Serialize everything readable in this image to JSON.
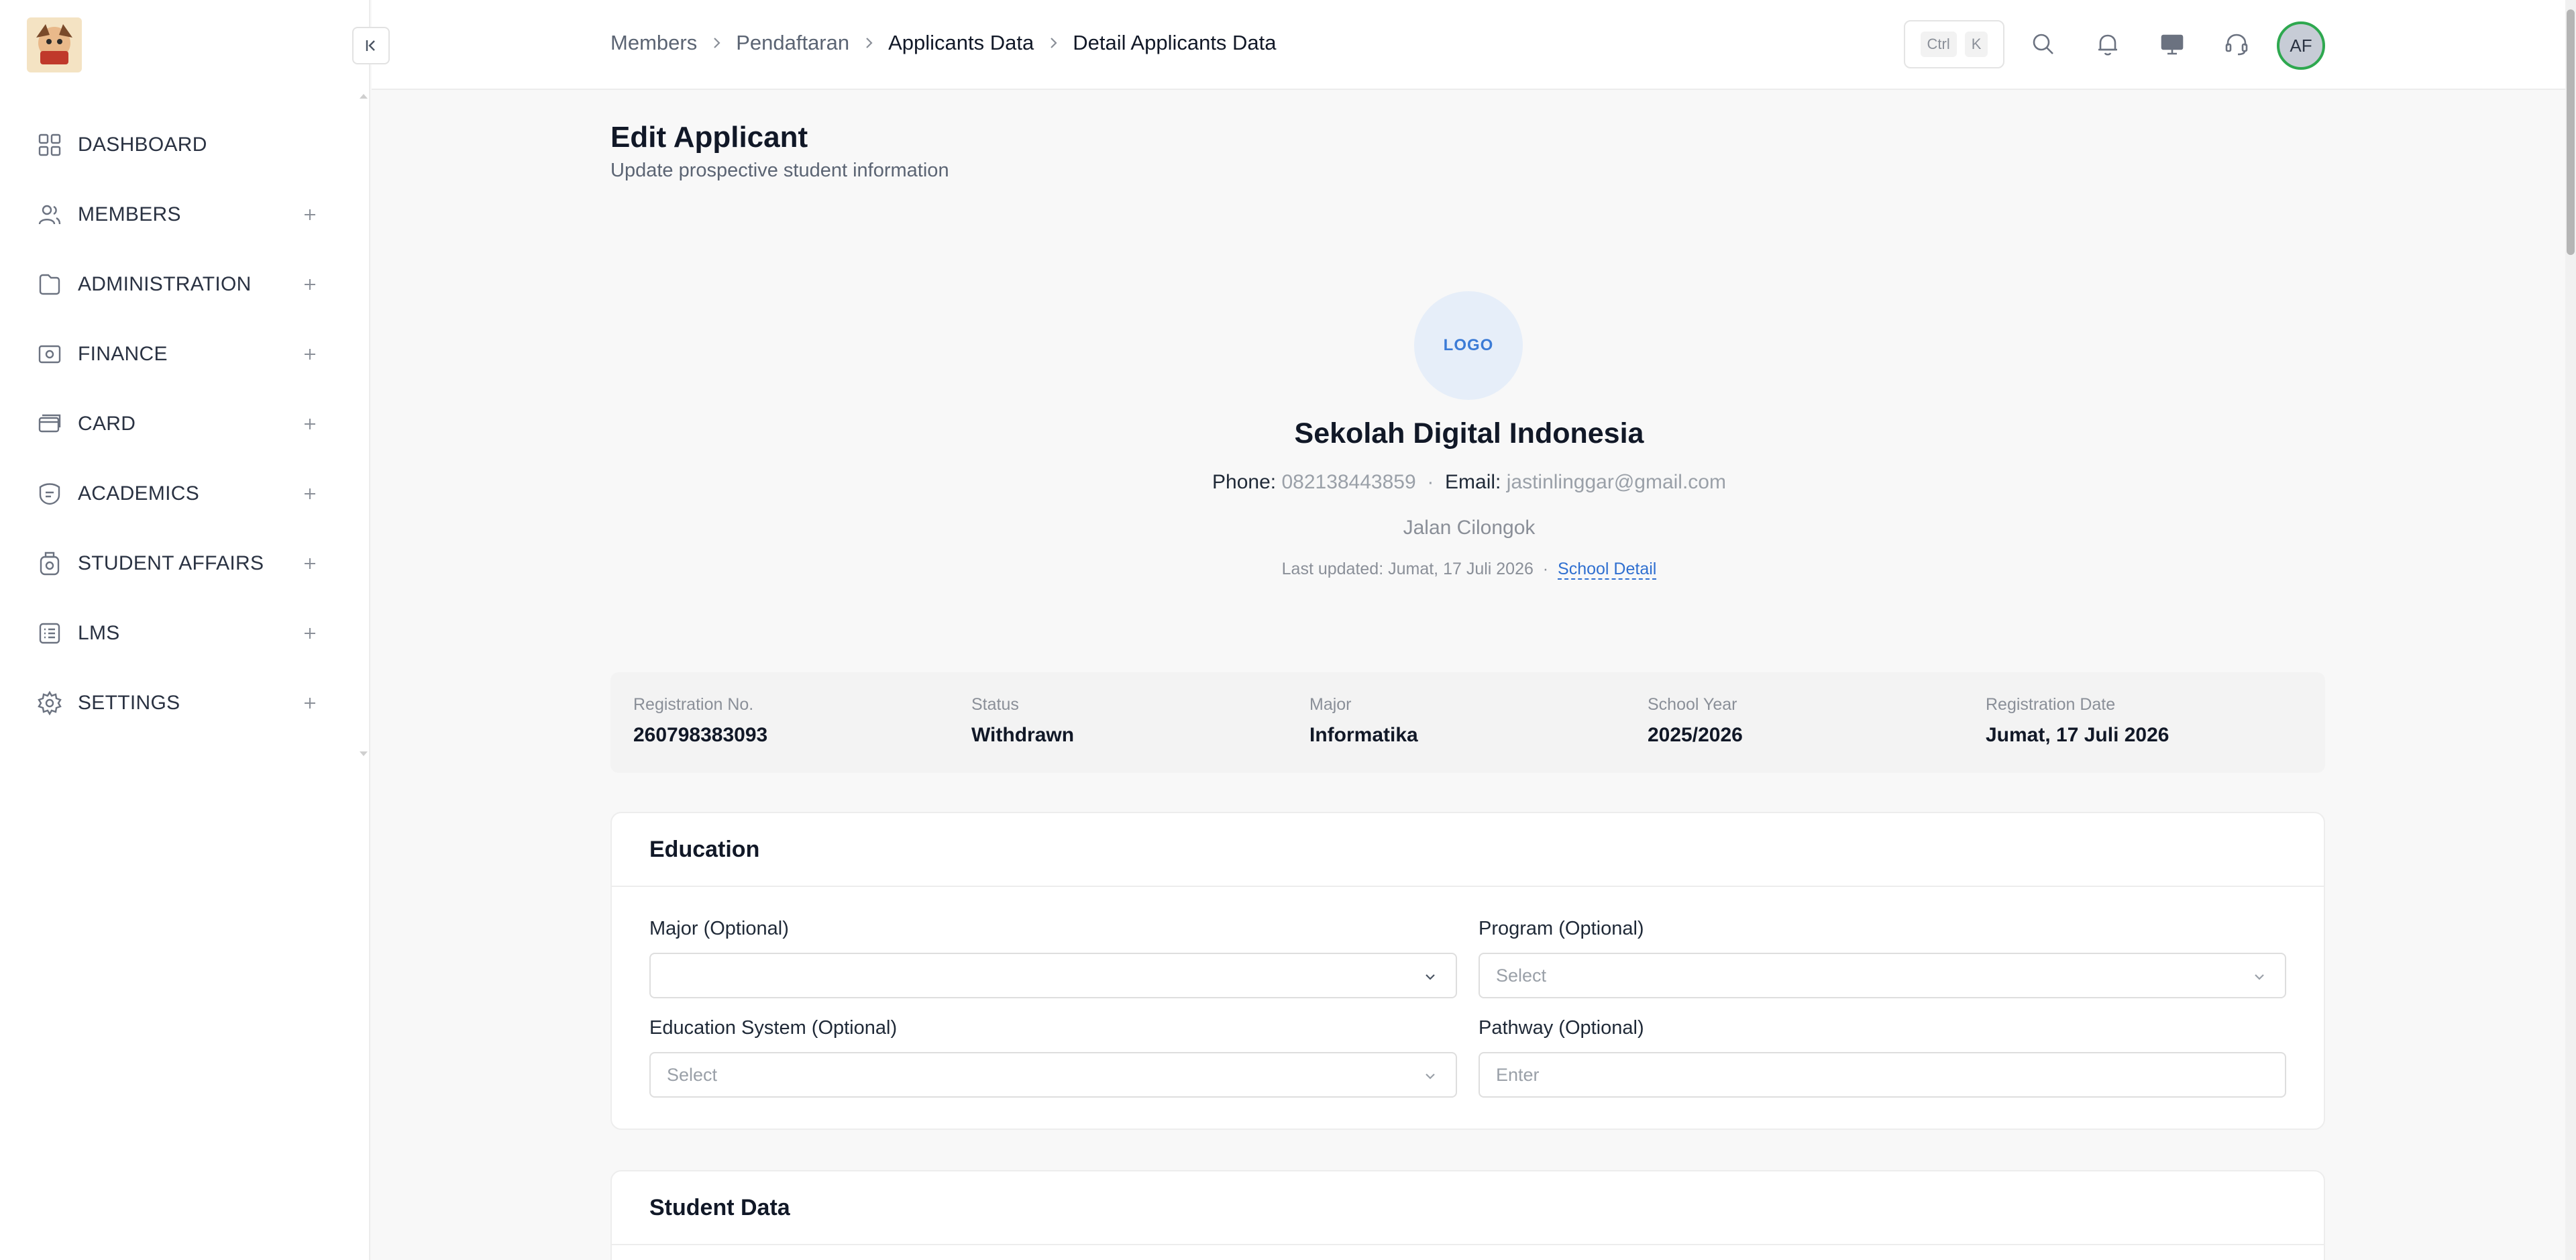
{
  "sidebar": {
    "items": [
      {
        "label": "DASHBOARD",
        "icon": "grid-icon",
        "expandable": false
      },
      {
        "label": "MEMBERS",
        "icon": "users-icon",
        "expandable": true
      },
      {
        "label": "ADMINISTRATION",
        "icon": "folder-icon",
        "expandable": true
      },
      {
        "label": "FINANCE",
        "icon": "money-icon",
        "expandable": true
      },
      {
        "label": "CARD",
        "icon": "card-icon",
        "expandable": true
      },
      {
        "label": "ACADEMICS",
        "icon": "academics-icon",
        "expandable": true
      },
      {
        "label": "STUDENT AFFAIRS",
        "icon": "badge-icon",
        "expandable": true
      },
      {
        "label": "LMS",
        "icon": "list-icon",
        "expandable": true
      },
      {
        "label": "SETTINGS",
        "icon": "gear-icon",
        "expandable": true
      }
    ]
  },
  "header": {
    "breadcrumb": [
      "Members",
      "Pendaftaran",
      "Applicants Data",
      "Detail Applicants Data"
    ],
    "shortcut": {
      "key1": "Ctrl",
      "key2": "K"
    },
    "avatar_initials": "AF"
  },
  "page": {
    "title": "Edit Applicant",
    "subtitle": "Update prospective student information"
  },
  "school": {
    "logo_text": "LOGO",
    "name": "Sekolah Digital Indonesia",
    "phone_label": "Phone:",
    "phone": "082138443859",
    "email_label": "Email:",
    "email": "jastinlinggar@gmail.com",
    "address": "Jalan Cilongok",
    "last_updated": "Last updated: Jumat, 17 Juli 2026",
    "detail_link": "School Detail"
  },
  "summary": [
    {
      "label": "Registration No.",
      "value": "260798383093"
    },
    {
      "label": "Status",
      "value": "Withdrawn"
    },
    {
      "label": "Major",
      "value": "Informatika"
    },
    {
      "label": "School Year",
      "value": "2025/2026"
    },
    {
      "label": "Registration Date",
      "value": "Jumat, 17 Juli 2026"
    }
  ],
  "education": {
    "title": "Education",
    "major_label": "Major (Optional)",
    "major_value": "",
    "program_label": "Program (Optional)",
    "program_placeholder": "Select",
    "system_label": "Education System (Optional)",
    "system_placeholder": "Select",
    "pathway_label": "Pathway (Optional)",
    "pathway_placeholder": "Enter"
  },
  "student_data": {
    "title": "Student Data"
  },
  "colors": {
    "accent": "#2f6fd0",
    "avatar_ring": "#2ea84f"
  }
}
